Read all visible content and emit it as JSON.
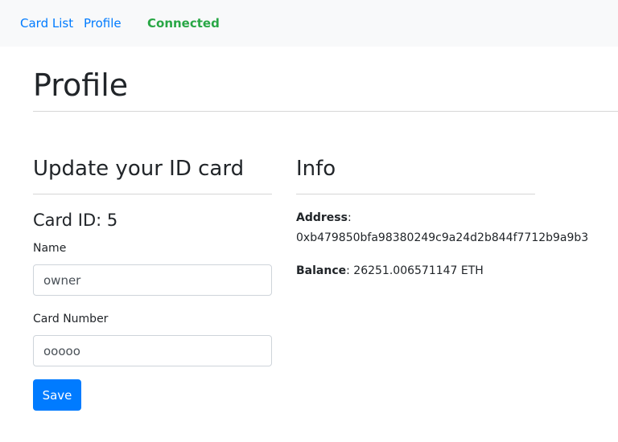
{
  "nav": {
    "card_list": "Card List",
    "profile": "Profile",
    "status": "Connected"
  },
  "page_title": "Profile",
  "update": {
    "heading": "Update your ID card",
    "card_id": "Card ID: 5",
    "name_label": "Name",
    "name_value": "owner",
    "number_label": "Card Number",
    "number_value": "ooooo",
    "save": "Save"
  },
  "info": {
    "heading": "Info",
    "address_label": "Address",
    "address": "0xb479850bfa98380249c9a24d2b844f7712b9a9b3",
    "balance_label": "Balance",
    "balance": "26251.006571147 ETH"
  }
}
